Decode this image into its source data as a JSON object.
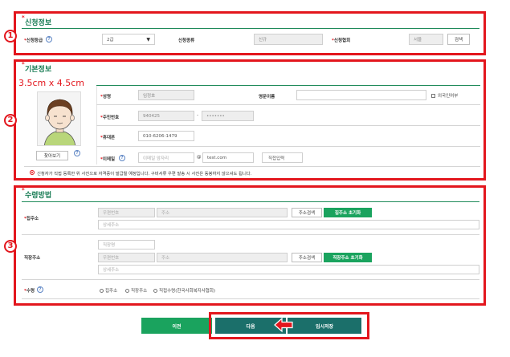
{
  "markers": [
    "1",
    "2",
    "3"
  ],
  "application": {
    "title": "신청정보",
    "grade_label": "신청등급",
    "grade_value": "2급",
    "type_label": "신청종류",
    "type_value": "신규",
    "assoc_label": "신청협회",
    "assoc_value": "서울",
    "search_button": "검색"
  },
  "basic": {
    "title": "기본정보",
    "photo_size_note": "3.5cm x 4.5cm",
    "find_button": "찾아보기",
    "name_label": "성명",
    "name_value": "임정호",
    "eng_name_label": "영문이름",
    "foreigner_label": "외국인여부",
    "rrn_label": "주민번호",
    "rrn_front": "940425",
    "rrn_dash": "-",
    "rrn_back": "•••••••",
    "phone_label": "휴대폰",
    "phone_value": "010-6206-1479",
    "email_label": "이메일",
    "email_id_placeholder": "이메일 앞자리",
    "email_at": "@",
    "email_domain": "test.com",
    "email_select": "직접입력",
    "notice": "신청자가 직접 등록한 위 사진으로 자격증이 발급될 예정입니다. 구비서류 우편 발송 시 사진은 동봉하지 않으셔도 됩니다."
  },
  "receipt": {
    "title": "수령방법",
    "home_label": "집주소",
    "zip_placeholder": "우편번호",
    "addr_placeholder": "주소",
    "detail_placeholder": "상세주소",
    "addr_search_button": "주소검색",
    "home_reset_button": "집주소 초기화",
    "work_label": "직장주소",
    "company_placeholder": "직장명",
    "work_reset_button": "직장주소 초기화",
    "method_label": "수령",
    "options": [
      "집주소",
      "직장주소",
      "직접수령(한국사회복지사협회)"
    ]
  },
  "footer": {
    "prev_button": "이전",
    "next_button": "다음",
    "temp_save_button": "임시저장"
  },
  "colors": {
    "annotation_red": "#e3161d",
    "section_green": "#157a52",
    "button_green": "#1aa35e",
    "teal_button": "#1b6f6a"
  }
}
